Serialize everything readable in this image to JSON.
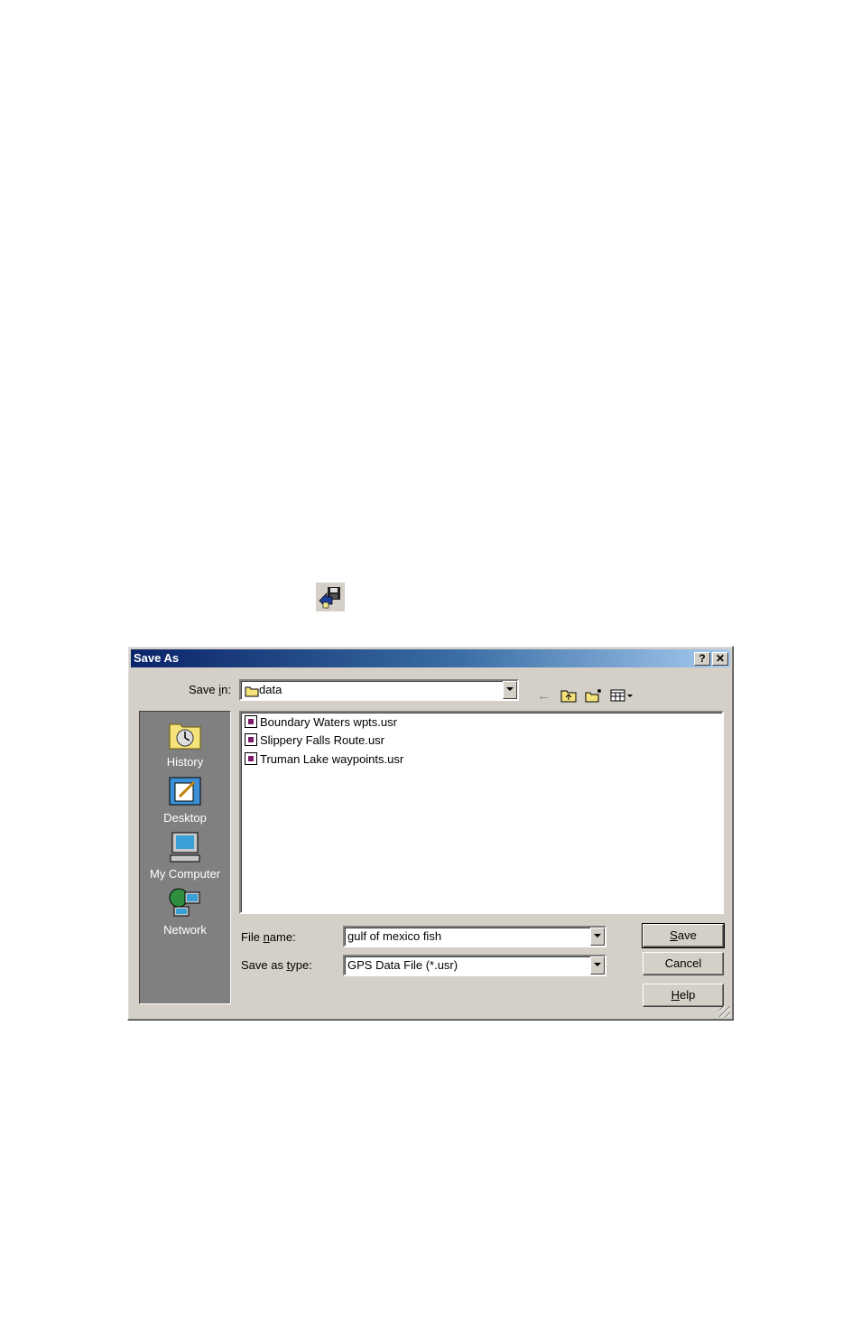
{
  "dialog": {
    "title": "Save As",
    "help_button": "?",
    "close_button": "✕"
  },
  "save_in": {
    "label_pre": "Save ",
    "label_key": "i",
    "label_post": "n:",
    "value": "data"
  },
  "places": [
    {
      "label": "History",
      "icon": "history-icon"
    },
    {
      "label": "Desktop",
      "icon": "desktop-icon"
    },
    {
      "label": "My Computer",
      "icon": "my-computer-icon"
    },
    {
      "label": "Network",
      "icon": "network-icon"
    }
  ],
  "files": [
    {
      "name": "Boundary Waters wpts.usr"
    },
    {
      "name": "Slippery Falls Route.usr"
    },
    {
      "name": "Truman Lake waypoints.usr"
    }
  ],
  "file_name": {
    "label_pre": "File ",
    "label_key": "n",
    "label_post": "ame:",
    "value": "gulf of mexico fish"
  },
  "save_as_type": {
    "label_pre": "Save as ",
    "label_key": "t",
    "label_post": "ype:",
    "value": "GPS Data File (*.usr)"
  },
  "buttons": {
    "save_key": "S",
    "save_rest": "ave",
    "cancel": "Cancel",
    "help_key": "H",
    "help_rest": "elp"
  },
  "toolbar_icon": "save-as-icon",
  "nav_icons": [
    "back-arrow-icon",
    "up-folder-icon",
    "new-folder-icon",
    "view-menu-icon"
  ]
}
